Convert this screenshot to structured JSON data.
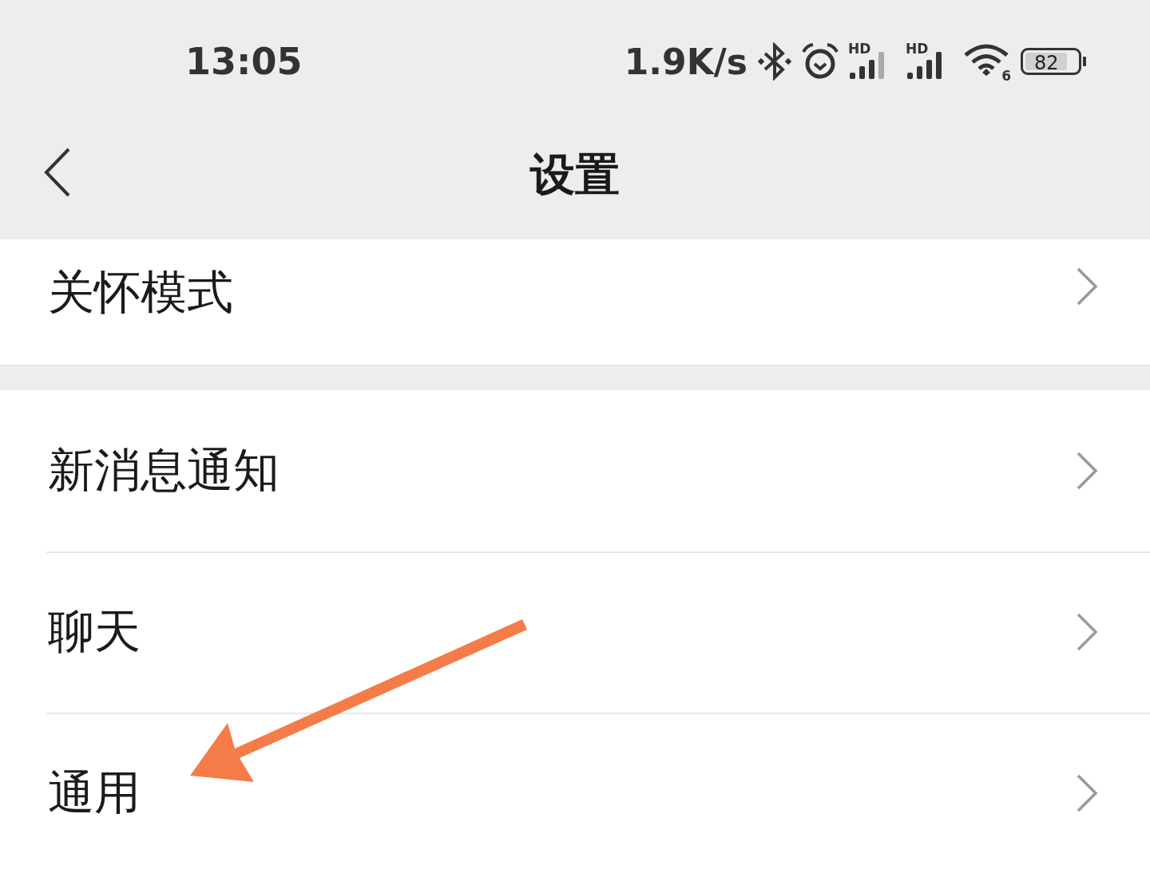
{
  "status_bar": {
    "time": "13:05",
    "net_speed": "1.9K/s",
    "signals": [
      {
        "label": "HD"
      },
      {
        "label": "HD"
      }
    ],
    "wifi_label": "6",
    "battery": "82"
  },
  "header": {
    "title": "设置"
  },
  "groups": [
    {
      "items": [
        {
          "label": "关怀模式"
        }
      ]
    },
    {
      "items": [
        {
          "label": "新消息通知"
        },
        {
          "label": "聊天"
        },
        {
          "label": "通用"
        }
      ]
    }
  ],
  "annotation": {
    "kind": "arrow"
  }
}
